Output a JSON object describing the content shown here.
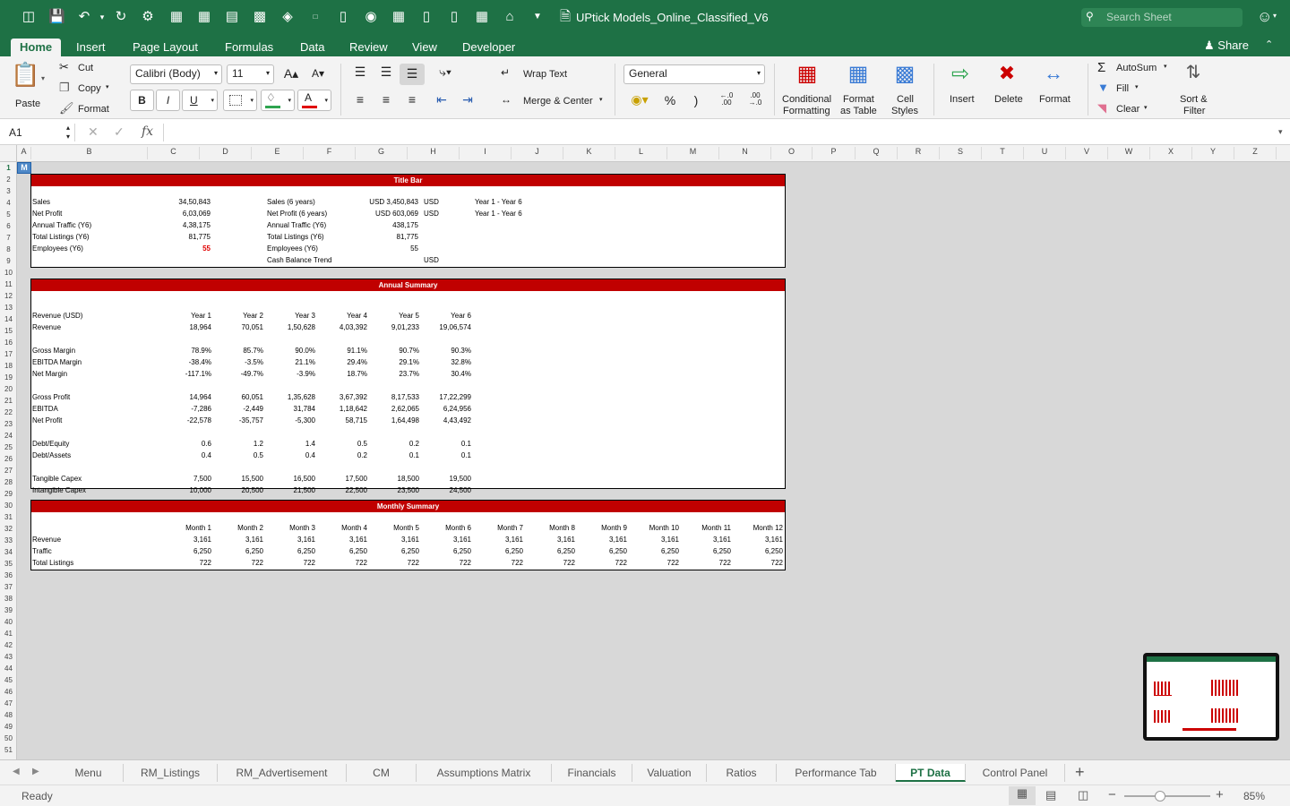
{
  "app": {
    "title": "UPtick Models_Online_Classified_V6",
    "search_placeholder": "Search Sheet",
    "share_label": "Share"
  },
  "ribbon_tabs": [
    "Home",
    "Insert",
    "Page Layout",
    "Formulas",
    "Data",
    "Review",
    "View",
    "Developer"
  ],
  "home": {
    "paste": "Paste",
    "cut": "Cut",
    "copy": "Copy",
    "format_painter": "Format",
    "font_name": "Calibri (Body)",
    "font_size": "11",
    "bold": "B",
    "italic": "I",
    "underline": "U",
    "wrap_text": "Wrap Text",
    "merge_center": "Merge & Center",
    "number_format": "General",
    "percent": "%",
    "comma": ")",
    "conditional_formatting": [
      "Conditional",
      "Formatting"
    ],
    "format_as_table": [
      "Format",
      "as Table"
    ],
    "cell_styles": [
      "Cell",
      "Styles"
    ],
    "insert": "Insert",
    "delete": "Delete",
    "format": "Format",
    "autosum": "AutoSum",
    "fill": "Fill",
    "clear": "Clear",
    "sort_filter": [
      "Sort &",
      "Filter"
    ]
  },
  "formula_bar": {
    "name_box": "A1",
    "fx": "fx",
    "content": ""
  },
  "columns": [
    "A",
    "B",
    "C",
    "D",
    "E",
    "F",
    "G",
    "H",
    "I",
    "J",
    "K",
    "L",
    "M",
    "N",
    "O",
    "P",
    "Q",
    "R",
    "S",
    "T",
    "U",
    "V",
    "W",
    "X",
    "Y",
    "Z"
  ],
  "rows_count": 51,
  "selected_cell_text": "M",
  "title_panel": {
    "header": "Title Bar",
    "left": [
      [
        "Sales",
        "34,50,843"
      ],
      [
        "Net Profit",
        "6,03,069"
      ],
      [
        "Annual Traffic (Y6)",
        "4,38,175"
      ],
      [
        "Total Listings (Y6)",
        "81,775"
      ],
      [
        "Employees (Y6)",
        "55"
      ]
    ],
    "right": [
      [
        "Sales (6 years)",
        "USD 3,450,843",
        "USD",
        "Year 1 - Year 6"
      ],
      [
        "Net Profit (6 years)",
        "USD 603,069",
        "USD",
        "Year 1 - Year 6"
      ],
      [
        "Annual Traffic (Y6)",
        "438,175",
        "",
        ""
      ],
      [
        "Total Listings (Y6)",
        "81,775",
        "",
        ""
      ],
      [
        "Employees (Y6)",
        "55",
        "",
        ""
      ],
      [
        "Cash Balance Trend",
        "",
        "USD",
        ""
      ]
    ]
  },
  "annual_panel": {
    "header": "Annual Summary",
    "col_label": "Revenue (USD)",
    "years": [
      "Year 1",
      "Year 2",
      "Year 3",
      "Year 4",
      "Year 5",
      "Year 6"
    ],
    "rows": [
      {
        "label": "Revenue",
        "row": 14,
        "values": [
          "18,964",
          "70,051",
          "1,50,628",
          "4,03,392",
          "9,01,233",
          "19,06,574"
        ]
      },
      {
        "label": "Gross Margin",
        "row": 16,
        "values": [
          "78.9%",
          "85.7%",
          "90.0%",
          "91.1%",
          "90.7%",
          "90.3%"
        ]
      },
      {
        "label": "EBITDA Margin",
        "row": 17,
        "values": [
          "-38.4%",
          "-3.5%",
          "21.1%",
          "29.4%",
          "29.1%",
          "32.8%"
        ]
      },
      {
        "label": "Net Margin",
        "row": 18,
        "values": [
          "-117.1%",
          "-49.7%",
          "-3.9%",
          "18.7%",
          "23.7%",
          "30.4%"
        ]
      },
      {
        "label": "Gross Profit",
        "row": 20,
        "values": [
          "14,964",
          "60,051",
          "1,35,628",
          "3,67,392",
          "8,17,533",
          "17,22,299"
        ]
      },
      {
        "label": "EBITDA",
        "row": 21,
        "values": [
          "-7,286",
          "-2,449",
          "31,784",
          "1,18,642",
          "2,62,065",
          "6,24,956"
        ]
      },
      {
        "label": "Net Profit",
        "row": 22,
        "values": [
          "-22,578",
          "-35,757",
          "-5,300",
          "58,715",
          "1,64,498",
          "4,43,492"
        ]
      },
      {
        "label": "Debt/Equity",
        "row": 24,
        "values": [
          "0.6",
          "1.2",
          "1.4",
          "0.5",
          "0.2",
          "0.1"
        ]
      },
      {
        "label": "Debt/Assets",
        "row": 25,
        "values": [
          "0.4",
          "0.5",
          "0.4",
          "0.2",
          "0.1",
          "0.1"
        ]
      },
      {
        "label": "Tangible Capex",
        "row": 27,
        "values": [
          "7,500",
          "15,500",
          "16,500",
          "17,500",
          "18,500",
          "19,500"
        ]
      },
      {
        "label": "Intangible Capex",
        "row": 28,
        "values": [
          "10,000",
          "20,500",
          "21,500",
          "22,500",
          "23,500",
          "24,500"
        ]
      }
    ]
  },
  "monthly_panel": {
    "header": "Monthly Summary",
    "months": [
      "Month 1",
      "Month 2",
      "Month 3",
      "Month 4",
      "Month 5",
      "Month 6",
      "Month 7",
      "Month 8",
      "Month 9",
      "Month 10",
      "Month 11",
      "Month 12"
    ],
    "rows": [
      {
        "label": "Revenue",
        "values": [
          "3,161",
          "3,161",
          "3,161",
          "3,161",
          "3,161",
          "3,161",
          "3,161",
          "3,161",
          "3,161",
          "3,161",
          "3,161",
          "3,161"
        ]
      },
      {
        "label": "Traffic",
        "values": [
          "6,250",
          "6,250",
          "6,250",
          "6,250",
          "6,250",
          "6,250",
          "6,250",
          "6,250",
          "6,250",
          "6,250",
          "6,250",
          "6,250"
        ]
      },
      {
        "label": "Total Listings",
        "values": [
          "722",
          "722",
          "722",
          "722",
          "722",
          "722",
          "722",
          "722",
          "722",
          "722",
          "722",
          "722"
        ]
      }
    ]
  },
  "sheet_tabs": [
    "Menu",
    "RM_Listings",
    "RM_Advertisement",
    "CM",
    "Assumptions Matrix",
    "Financials",
    "Valuation",
    "Ratios",
    "Performance Tab",
    "PT Data",
    "Control Panel"
  ],
  "active_sheet": "PT Data",
  "status": {
    "text": "Ready",
    "zoom": "85%"
  },
  "colors": {
    "excel_green": "#1e7145",
    "header_red": "#c00000"
  }
}
